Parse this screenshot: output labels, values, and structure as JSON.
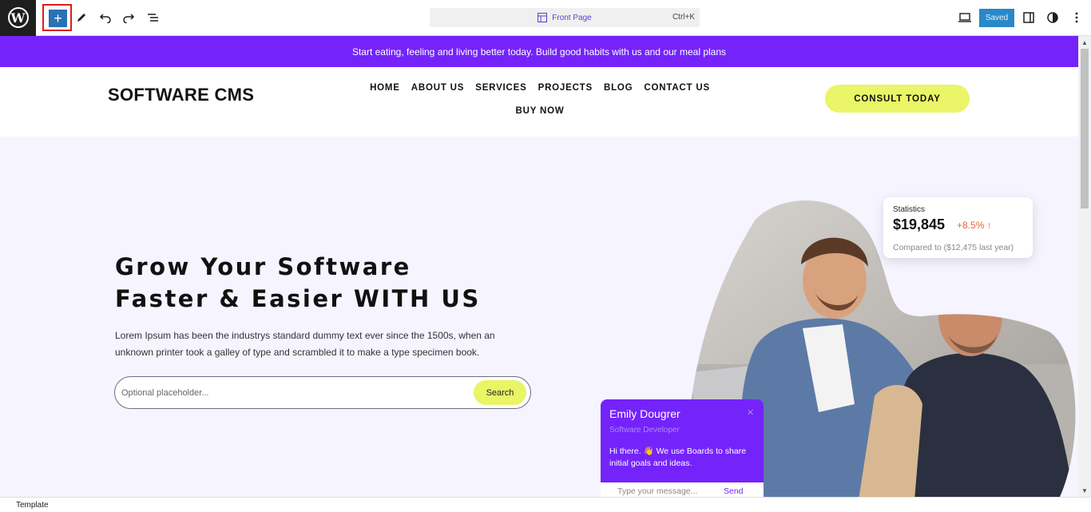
{
  "toolbar": {
    "add_label": "+",
    "document_title": "Front Page",
    "shortcut": "Ctrl+K",
    "save_status": "Saved"
  },
  "site": {
    "promo_text": "Start eating, feeling and living better today. Build good habits with us and our meal plans",
    "brand": "SOFTWARE CMS",
    "nav": [
      "HOME",
      "ABOUT US",
      "SERVICES",
      "PROJECTS",
      "BLOG",
      "CONTACT US",
      "BUY NOW"
    ],
    "cta": "CONSULT TODAY"
  },
  "hero": {
    "title_line1": "Grow Your Software",
    "title_line2": "Faster & Easier WITH US",
    "lead_line1": "Lorem Ipsum has been the industrys standard dummy text ever since the 1500s, when an",
    "lead_line2": "unknown printer took a galley of type and scrambled it to make a type specimen book.",
    "search_placeholder": "Optional placeholder...",
    "search_button": "Search"
  },
  "stats_card": {
    "label": "Statistics",
    "value": "$19,845",
    "change": "+8.5%",
    "compare": "Compared to ($12,475 last year)"
  },
  "chat_card": {
    "name": "Emily Dougrer",
    "role": "Software Developer",
    "message": "Hi there. 👋 We use Boards to share initial goals and ideas.",
    "close": "×",
    "input_placeholder": "Type your message...",
    "send": "Send"
  },
  "footer": {
    "breadcrumb": "Template"
  },
  "colors": {
    "accent": "#7423fb",
    "cta": "#eaf567",
    "hero_bg": "#f5f4ff",
    "wp_blue": "#2a71b5"
  }
}
